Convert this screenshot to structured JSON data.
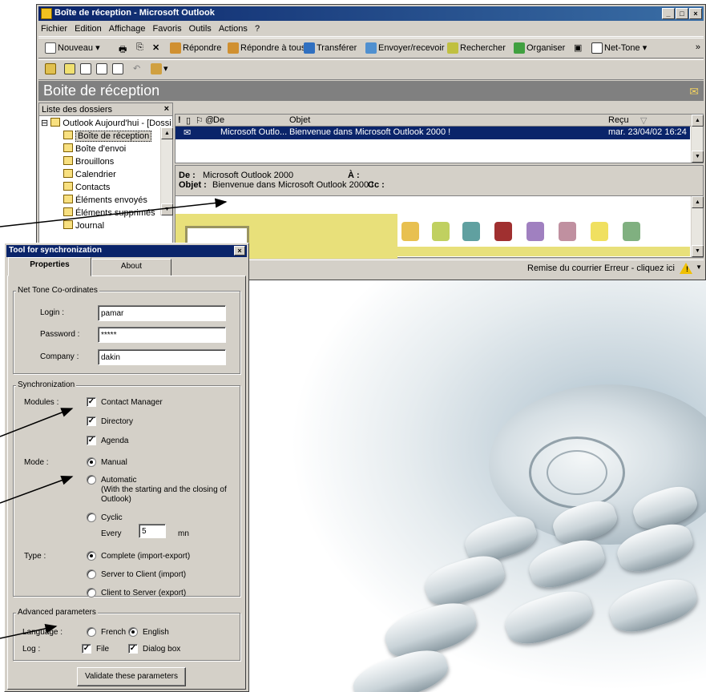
{
  "outlook": {
    "title": "Boîte de réception - Microsoft Outlook",
    "menu": [
      "Fichier",
      "Edition",
      "Affichage",
      "Favoris",
      "Outils",
      "Actions",
      "?"
    ],
    "toolbar": {
      "new": "Nouveau",
      "reply": "Répondre",
      "reply_all": "Répondre à tous",
      "forward": "Transférer",
      "send_receive": "Envoyer/recevoir",
      "find": "Rechercher",
      "organize": "Organiser",
      "nettone": "Net-Tone"
    },
    "folder_title": "Boite de réception",
    "folder_list": {
      "header": "Liste des dossiers",
      "close": "×",
      "root": "Outlook Aujourd'hui - [Dossi",
      "items": [
        "Boîte de réception",
        "Boîte d'envoi",
        "Brouillons",
        "Calendrier",
        "Contacts",
        "Éléments envoyés",
        "Éléments supprimés",
        "Journal"
      ]
    },
    "message_list": {
      "col_from": "De",
      "col_subject": "Objet",
      "col_received": "Reçu",
      "row": {
        "from": "Microsoft Outlo...",
        "subject": "Bienvenue dans Microsoft Outlook 2000 !",
        "received": "mar. 23/04/02 16:24"
      }
    },
    "preview": {
      "from_label": "De :",
      "from_value": "Microsoft Outlook 2000",
      "to_label": "À :",
      "subject_label": "Objet :",
      "subject_value": "Bienvenue dans Microsoft Outlook 2000 !",
      "cc_label": "Cc :"
    },
    "status": "Remise du courrier Erreur - cliquez ici"
  },
  "sync_dialog": {
    "title": "Tool for synchronization",
    "tabs": [
      "Properties",
      "About"
    ],
    "coordinates": {
      "group": "Net Tone Co-ordinates",
      "login_label": "Login :",
      "login_value": "pamar",
      "password_label": "Password :",
      "password_value": "*****",
      "company_label": "Company :",
      "company_value": "dakin"
    },
    "synchronization": {
      "group": "Synchronization",
      "modules_label": "Modules :",
      "modules": [
        "Contact Manager",
        "Directory",
        "Agenda"
      ],
      "mode_label": "Mode :",
      "mode_manual": "Manual",
      "mode_automatic": "Automatic",
      "mode_automatic_note_1": "(With the starting and the closing of",
      "mode_automatic_note_2": "Outlook)",
      "mode_cyclic": "Cyclic",
      "every_label": "Every",
      "every_value": "5",
      "every_unit": "mn",
      "type_label": "Type :",
      "type_options": [
        "Complete (import-export)",
        "Server to Client (import)",
        "Client to Server (export)"
      ]
    },
    "advanced": {
      "group": "Advanced parameters",
      "language_label": "Language :",
      "lang_french": "French",
      "lang_english": "English",
      "log_label": "Log :",
      "log_file": "File",
      "log_dialog": "Dialog box"
    },
    "validate_button": "Validate these parameters"
  }
}
